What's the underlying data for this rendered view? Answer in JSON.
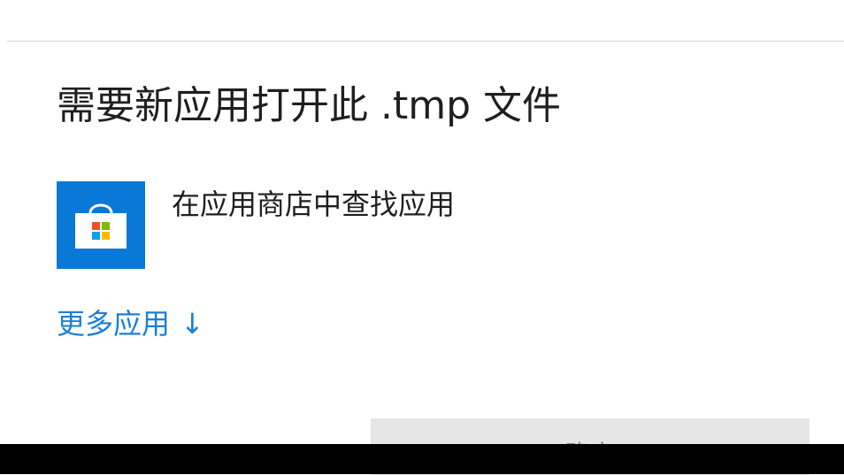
{
  "dialog": {
    "title": "需要新应用打开此 .tmp 文件",
    "store_option": {
      "label": "在应用商店中查找应用",
      "icon": "microsoft-store-icon"
    },
    "more_apps": {
      "label": "更多应用",
      "arrow": "↓"
    },
    "ok_button": {
      "label": "确定"
    }
  },
  "colors": {
    "store_tile": "#0a78d7",
    "link": "#1a7fd4",
    "title_text": "#1f1f1f",
    "button_bg": "#e6e6e6"
  }
}
